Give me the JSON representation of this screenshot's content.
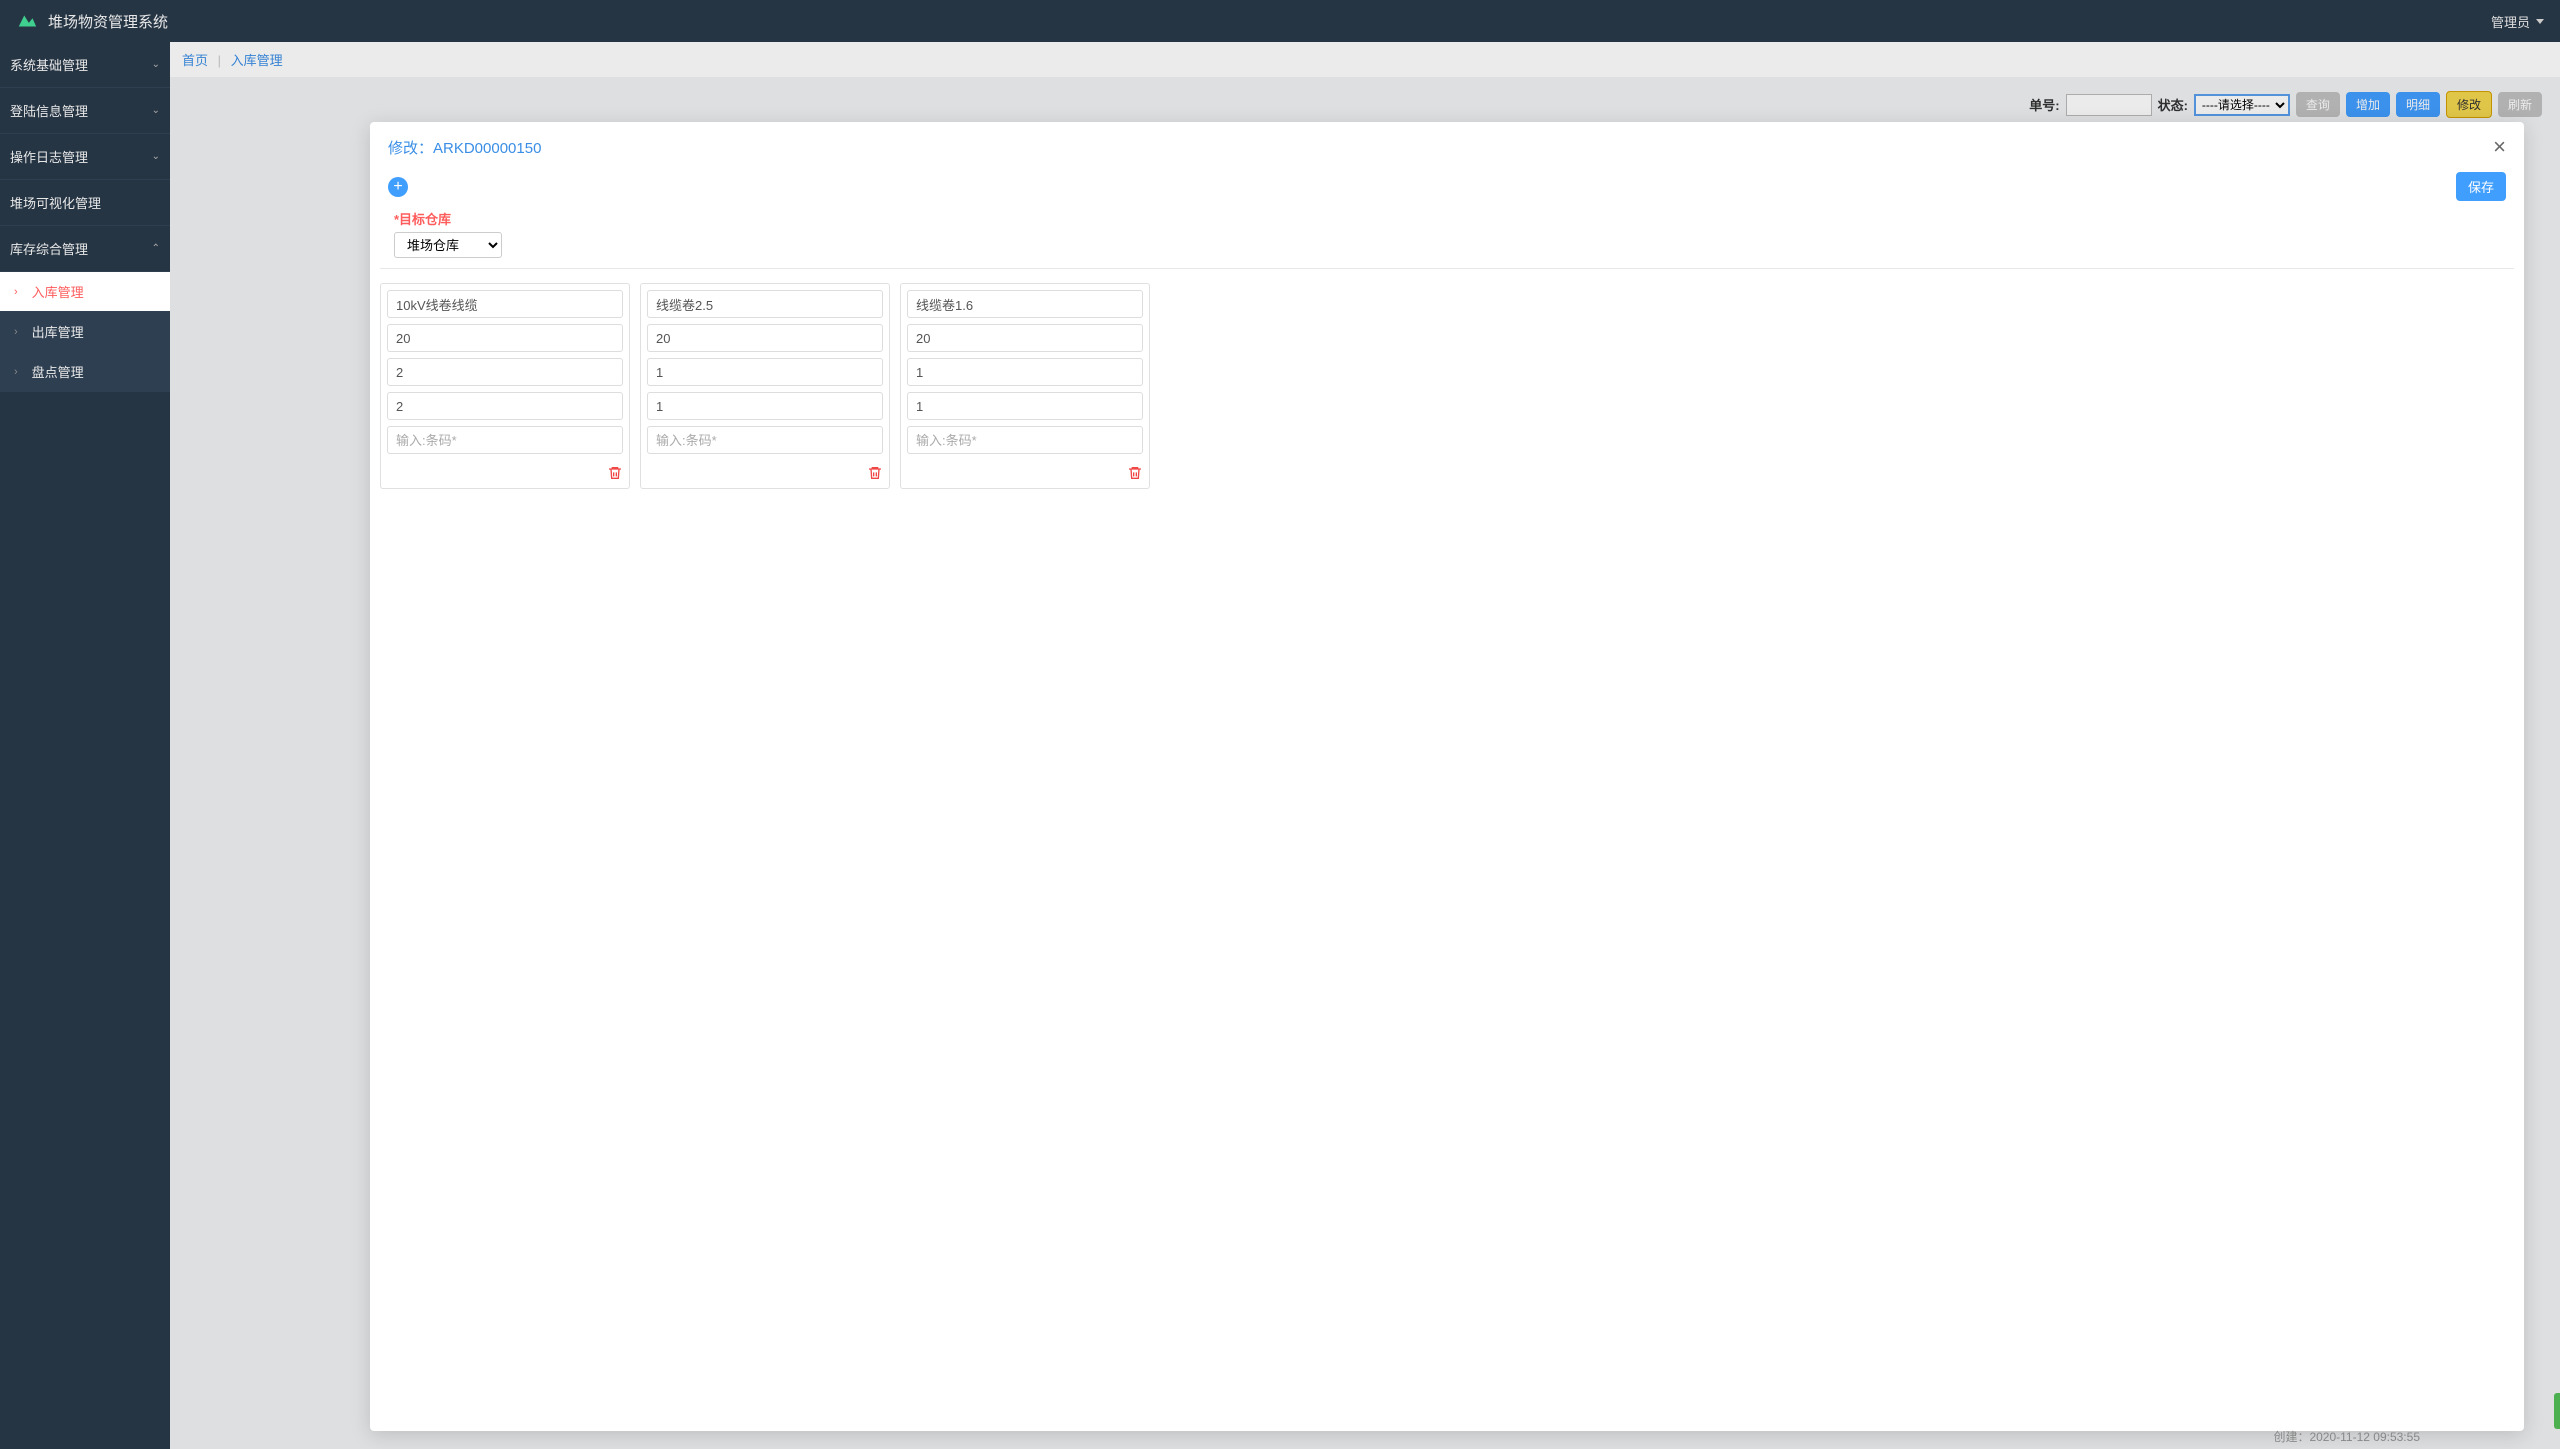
{
  "header": {
    "title": "堆场物资管理系统",
    "user": "管理员"
  },
  "sidebar": {
    "items": [
      {
        "label": "系统基础管理",
        "expanded": false
      },
      {
        "label": "登陆信息管理",
        "expanded": false
      },
      {
        "label": "操作日志管理",
        "expanded": false
      },
      {
        "label": "堆场可视化管理",
        "expanded": null
      },
      {
        "label": "库存综合管理",
        "expanded": true
      }
    ],
    "sub_items": [
      {
        "label": "入库管理",
        "active": true
      },
      {
        "label": "出库管理",
        "active": false
      },
      {
        "label": "盘点管理",
        "active": false
      }
    ]
  },
  "breadcrumb": {
    "home": "首页",
    "current": "入库管理"
  },
  "toolbar": {
    "label_order": "单号:",
    "label_status": "状态:",
    "status_placeholder": "----请选择----",
    "btn_query": "查询",
    "btn_add": "增加",
    "btn_detail": "明细",
    "btn_edit": "修改",
    "btn_refresh": "刷新"
  },
  "modal": {
    "title": "修改：ARKD00000150",
    "save": "保存",
    "target_label": "*目标仓库",
    "target_value": "堆场仓库",
    "barcode_placeholder": "输入:条码*",
    "cards": [
      {
        "name": "10kV线卷线缆",
        "f1": "20",
        "f2": "2",
        "f3": "2"
      },
      {
        "name": "线缆卷2.5",
        "f1": "20",
        "f2": "1",
        "f3": "1"
      },
      {
        "name": "线缆卷1.6",
        "f1": "20",
        "f2": "1",
        "f3": "1"
      }
    ]
  },
  "footer": {
    "created": "创建：2020-11-12 09:53:55"
  }
}
